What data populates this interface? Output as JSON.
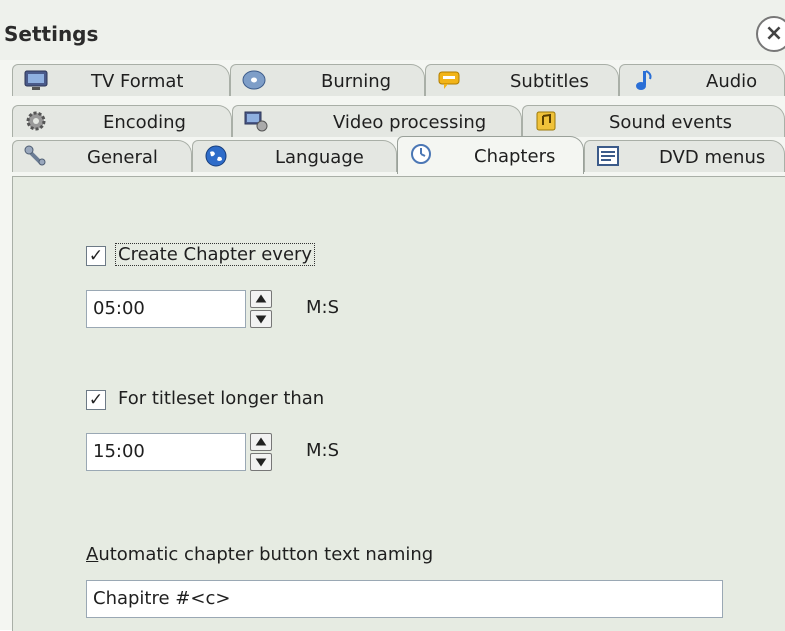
{
  "window": {
    "title": "Settings",
    "close_symbol": "×"
  },
  "tabs": {
    "row1": [
      {
        "label": "TV Format",
        "icon": "monitor-icon"
      },
      {
        "label": "Burning",
        "icon": "disc-icon"
      },
      {
        "label": "Subtitles",
        "icon": "speech-bubble-icon"
      },
      {
        "label": "Audio",
        "icon": "music-note-icon"
      }
    ],
    "row2": [
      {
        "label": "Encoding",
        "icon": "gear-icon"
      },
      {
        "label": "Video processing",
        "icon": "video-processing-icon"
      },
      {
        "label": "Sound events",
        "icon": "sound-events-icon"
      }
    ],
    "row3": [
      {
        "label": "General",
        "icon": "tools-icon"
      },
      {
        "label": "Language",
        "icon": "globe-icon"
      },
      {
        "label": "Chapters",
        "icon": "clock-icon",
        "selected": true
      },
      {
        "label": "DVD menus",
        "icon": "menu-list-icon"
      }
    ]
  },
  "chapters": {
    "create_every": {
      "label": "Create Chapter every",
      "checked": true,
      "value": "05:00",
      "unit": "M:S"
    },
    "titleset_longer": {
      "label": "For titleset longer than",
      "checked": true,
      "value": "15:00",
      "unit": "M:S"
    },
    "naming": {
      "label_accel": "A",
      "label_rest": "utomatic chapter button text naming",
      "value": "Chapitre #<c>"
    }
  },
  "colors": {
    "tab_bg": "#e4e7e2",
    "panel_bg": "#e6ebe2",
    "selected_tab_bg": "#f4f6f2"
  }
}
